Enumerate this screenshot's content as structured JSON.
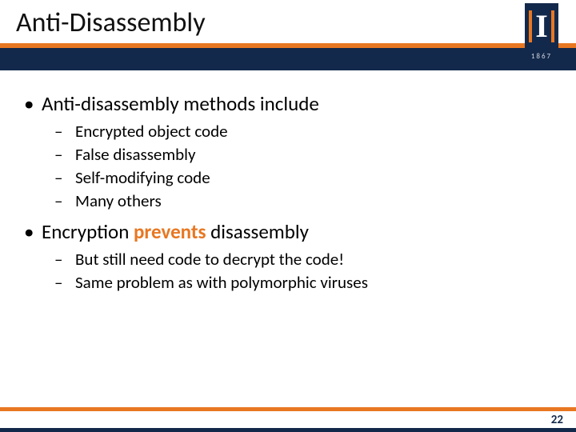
{
  "title": "Anti-Disassembly",
  "logo": {
    "letter": "I",
    "year": "1867"
  },
  "bullets": [
    {
      "text_pre": "Anti-disassembly methods include",
      "accent": "",
      "text_post": "",
      "sub": [
        "Encrypted object code",
        "False disassembly",
        "Self-modifying code",
        "Many others"
      ]
    },
    {
      "text_pre": "Encryption ",
      "accent": "prevents",
      "text_post": " disassembly",
      "sub": [
        "But still need code to decrypt the code!",
        "Same problem as with polymorphic viruses"
      ]
    }
  ],
  "page_number": "22",
  "glyphs": {
    "dot": "•",
    "dash": "–"
  }
}
